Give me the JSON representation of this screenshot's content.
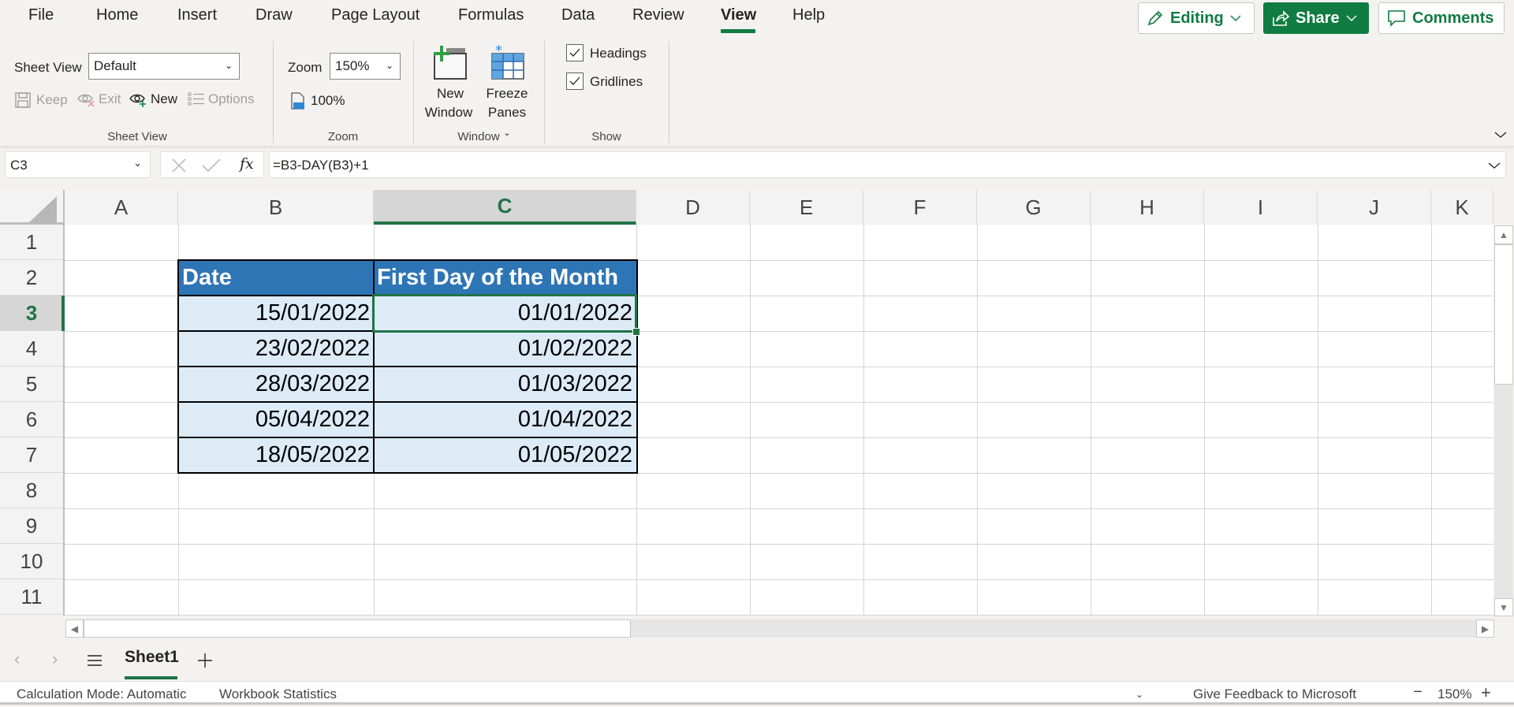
{
  "menu": {
    "tabs": [
      {
        "label": "File"
      },
      {
        "label": "Home"
      },
      {
        "label": "Insert"
      },
      {
        "label": "Draw"
      },
      {
        "label": "Page Layout"
      },
      {
        "label": "Formulas"
      },
      {
        "label": "Data"
      },
      {
        "label": "Review"
      },
      {
        "label": "View",
        "active": true
      },
      {
        "label": "Help"
      }
    ],
    "editing_label": "Editing",
    "share_label": "Share",
    "comments_label": "Comments"
  },
  "ribbon": {
    "sheet_view": {
      "label": "Sheet View",
      "select_value": "Default",
      "keep": "Keep",
      "exit": "Exit",
      "new": "New",
      "options": "Options",
      "group_label": "Sheet View"
    },
    "zoom": {
      "label": "Zoom",
      "select_value": "150%",
      "hundred": "100%",
      "group_label": "Zoom"
    },
    "window": {
      "new_window_line1": "New",
      "new_window_line2": "Window",
      "freeze_line1": "Freeze",
      "freeze_line2": "Panes",
      "group_label": "Window"
    },
    "show": {
      "headings": "Headings",
      "headings_checked": true,
      "gridlines": "Gridlines",
      "gridlines_checked": true,
      "group_label": "Show"
    }
  },
  "formula_bar": {
    "name_box": "C3",
    "formula": "=B3-DAY(B3)+1"
  },
  "grid": {
    "columns": [
      "A",
      "B",
      "C",
      "D",
      "E",
      "F",
      "G",
      "H",
      "I",
      "J",
      "K"
    ],
    "selected_column": "C",
    "rows": [
      "1",
      "2",
      "3",
      "4",
      "5",
      "6",
      "7",
      "8",
      "9",
      "10",
      "11"
    ],
    "selected_row": "3",
    "table": {
      "headers": [
        "Date",
        "First Day of the Month"
      ],
      "rows": [
        [
          "15/01/2022",
          "01/01/2022"
        ],
        [
          "23/02/2022",
          "01/02/2022"
        ],
        [
          "28/03/2022",
          "01/03/2022"
        ],
        [
          "05/04/2022",
          "01/04/2022"
        ],
        [
          "18/05/2022",
          "01/05/2022"
        ]
      ]
    },
    "header_color": "#2e75b6",
    "cell_fill_color": "#ddebf7",
    "selection_color": "#217346"
  },
  "sheets": {
    "tabs": [
      "Sheet1"
    ],
    "active": "Sheet1"
  },
  "status_bar": {
    "calc_mode": "Calculation Mode: Automatic",
    "workbook_stats": "Workbook Statistics",
    "feedback": "Give Feedback to Microsoft",
    "zoom": "150%"
  }
}
